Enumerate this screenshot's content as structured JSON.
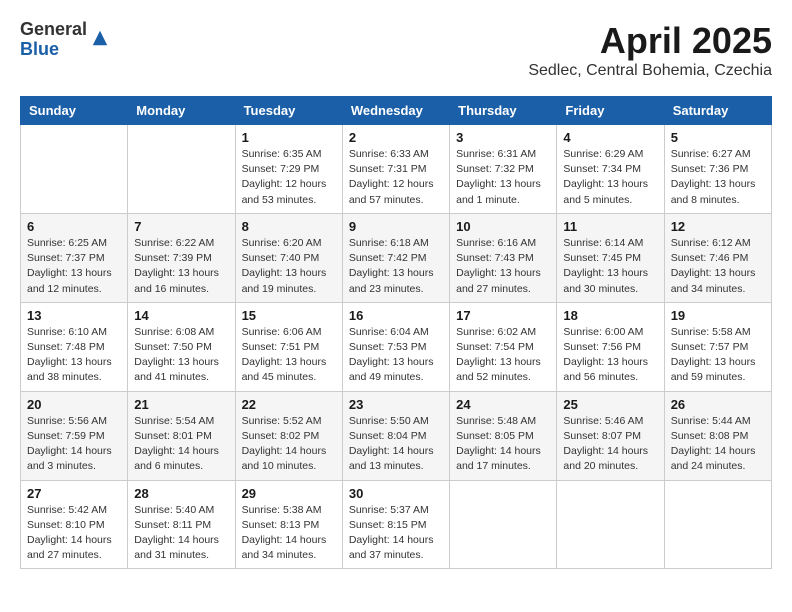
{
  "logo": {
    "general": "General",
    "blue": "Blue"
  },
  "header": {
    "month": "April 2025",
    "location": "Sedlec, Central Bohemia, Czechia"
  },
  "weekdays": [
    "Sunday",
    "Monday",
    "Tuesday",
    "Wednesday",
    "Thursday",
    "Friday",
    "Saturday"
  ],
  "weeks": [
    [
      null,
      null,
      {
        "day": "1",
        "sunrise": "Sunrise: 6:35 AM",
        "sunset": "Sunset: 7:29 PM",
        "daylight": "Daylight: 12 hours and 53 minutes."
      },
      {
        "day": "2",
        "sunrise": "Sunrise: 6:33 AM",
        "sunset": "Sunset: 7:31 PM",
        "daylight": "Daylight: 12 hours and 57 minutes."
      },
      {
        "day": "3",
        "sunrise": "Sunrise: 6:31 AM",
        "sunset": "Sunset: 7:32 PM",
        "daylight": "Daylight: 13 hours and 1 minute."
      },
      {
        "day": "4",
        "sunrise": "Sunrise: 6:29 AM",
        "sunset": "Sunset: 7:34 PM",
        "daylight": "Daylight: 13 hours and 5 minutes."
      },
      {
        "day": "5",
        "sunrise": "Sunrise: 6:27 AM",
        "sunset": "Sunset: 7:36 PM",
        "daylight": "Daylight: 13 hours and 8 minutes."
      }
    ],
    [
      {
        "day": "6",
        "sunrise": "Sunrise: 6:25 AM",
        "sunset": "Sunset: 7:37 PM",
        "daylight": "Daylight: 13 hours and 12 minutes."
      },
      {
        "day": "7",
        "sunrise": "Sunrise: 6:22 AM",
        "sunset": "Sunset: 7:39 PM",
        "daylight": "Daylight: 13 hours and 16 minutes."
      },
      {
        "day": "8",
        "sunrise": "Sunrise: 6:20 AM",
        "sunset": "Sunset: 7:40 PM",
        "daylight": "Daylight: 13 hours and 19 minutes."
      },
      {
        "day": "9",
        "sunrise": "Sunrise: 6:18 AM",
        "sunset": "Sunset: 7:42 PM",
        "daylight": "Daylight: 13 hours and 23 minutes."
      },
      {
        "day": "10",
        "sunrise": "Sunrise: 6:16 AM",
        "sunset": "Sunset: 7:43 PM",
        "daylight": "Daylight: 13 hours and 27 minutes."
      },
      {
        "day": "11",
        "sunrise": "Sunrise: 6:14 AM",
        "sunset": "Sunset: 7:45 PM",
        "daylight": "Daylight: 13 hours and 30 minutes."
      },
      {
        "day": "12",
        "sunrise": "Sunrise: 6:12 AM",
        "sunset": "Sunset: 7:46 PM",
        "daylight": "Daylight: 13 hours and 34 minutes."
      }
    ],
    [
      {
        "day": "13",
        "sunrise": "Sunrise: 6:10 AM",
        "sunset": "Sunset: 7:48 PM",
        "daylight": "Daylight: 13 hours and 38 minutes."
      },
      {
        "day": "14",
        "sunrise": "Sunrise: 6:08 AM",
        "sunset": "Sunset: 7:50 PM",
        "daylight": "Daylight: 13 hours and 41 minutes."
      },
      {
        "day": "15",
        "sunrise": "Sunrise: 6:06 AM",
        "sunset": "Sunset: 7:51 PM",
        "daylight": "Daylight: 13 hours and 45 minutes."
      },
      {
        "day": "16",
        "sunrise": "Sunrise: 6:04 AM",
        "sunset": "Sunset: 7:53 PM",
        "daylight": "Daylight: 13 hours and 49 minutes."
      },
      {
        "day": "17",
        "sunrise": "Sunrise: 6:02 AM",
        "sunset": "Sunset: 7:54 PM",
        "daylight": "Daylight: 13 hours and 52 minutes."
      },
      {
        "day": "18",
        "sunrise": "Sunrise: 6:00 AM",
        "sunset": "Sunset: 7:56 PM",
        "daylight": "Daylight: 13 hours and 56 minutes."
      },
      {
        "day": "19",
        "sunrise": "Sunrise: 5:58 AM",
        "sunset": "Sunset: 7:57 PM",
        "daylight": "Daylight: 13 hours and 59 minutes."
      }
    ],
    [
      {
        "day": "20",
        "sunrise": "Sunrise: 5:56 AM",
        "sunset": "Sunset: 7:59 PM",
        "daylight": "Daylight: 14 hours and 3 minutes."
      },
      {
        "day": "21",
        "sunrise": "Sunrise: 5:54 AM",
        "sunset": "Sunset: 8:01 PM",
        "daylight": "Daylight: 14 hours and 6 minutes."
      },
      {
        "day": "22",
        "sunrise": "Sunrise: 5:52 AM",
        "sunset": "Sunset: 8:02 PM",
        "daylight": "Daylight: 14 hours and 10 minutes."
      },
      {
        "day": "23",
        "sunrise": "Sunrise: 5:50 AM",
        "sunset": "Sunset: 8:04 PM",
        "daylight": "Daylight: 14 hours and 13 minutes."
      },
      {
        "day": "24",
        "sunrise": "Sunrise: 5:48 AM",
        "sunset": "Sunset: 8:05 PM",
        "daylight": "Daylight: 14 hours and 17 minutes."
      },
      {
        "day": "25",
        "sunrise": "Sunrise: 5:46 AM",
        "sunset": "Sunset: 8:07 PM",
        "daylight": "Daylight: 14 hours and 20 minutes."
      },
      {
        "day": "26",
        "sunrise": "Sunrise: 5:44 AM",
        "sunset": "Sunset: 8:08 PM",
        "daylight": "Daylight: 14 hours and 24 minutes."
      }
    ],
    [
      {
        "day": "27",
        "sunrise": "Sunrise: 5:42 AM",
        "sunset": "Sunset: 8:10 PM",
        "daylight": "Daylight: 14 hours and 27 minutes."
      },
      {
        "day": "28",
        "sunrise": "Sunrise: 5:40 AM",
        "sunset": "Sunset: 8:11 PM",
        "daylight": "Daylight: 14 hours and 31 minutes."
      },
      {
        "day": "29",
        "sunrise": "Sunrise: 5:38 AM",
        "sunset": "Sunset: 8:13 PM",
        "daylight": "Daylight: 14 hours and 34 minutes."
      },
      {
        "day": "30",
        "sunrise": "Sunrise: 5:37 AM",
        "sunset": "Sunset: 8:15 PM",
        "daylight": "Daylight: 14 hours and 37 minutes."
      },
      null,
      null,
      null
    ]
  ]
}
